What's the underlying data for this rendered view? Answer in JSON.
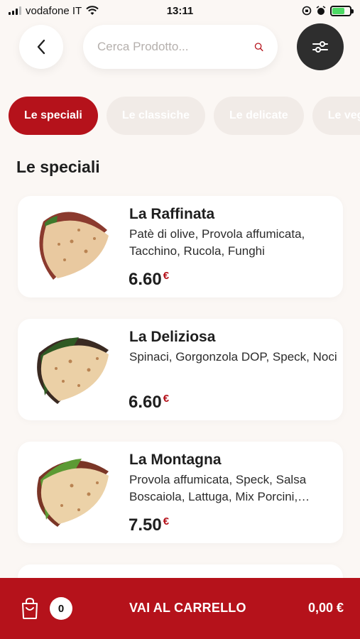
{
  "status_bar": {
    "carrier": "vodafone IT",
    "time": "13:11",
    "battery_level": 0.7
  },
  "header": {
    "search_placeholder": "Cerca Prodotto..."
  },
  "categories": [
    {
      "label": "Le speciali",
      "active": true
    },
    {
      "label": "Le classiche",
      "active": false
    },
    {
      "label": "Le delicate",
      "active": false
    },
    {
      "label": "Le veg",
      "active": false
    }
  ],
  "section": {
    "title": "Le speciali"
  },
  "products": [
    {
      "name": "La Raffinata",
      "description": "Patè di olive, Provola affumicata, Tacchino, Rucola, Funghi",
      "price": "6.60",
      "currency": "€"
    },
    {
      "name": "La Deliziosa",
      "description": "Spinaci, Gorgonzola DOP, Speck, Noci",
      "price": "6.60",
      "currency": "€"
    },
    {
      "name": "La Montagna",
      "description": "Provola affumicata, Speck, Salsa Boscaiola, Lattuga, Mix Porcini,…",
      "price": "7.50",
      "currency": "€"
    }
  ],
  "cart": {
    "count": "0",
    "label": "VAI AL CARRELLO",
    "total": "0,00 €"
  },
  "colors": {
    "brand_red": "#b5121b",
    "dark": "#2e2e2e",
    "background": "#fbf7f4"
  }
}
